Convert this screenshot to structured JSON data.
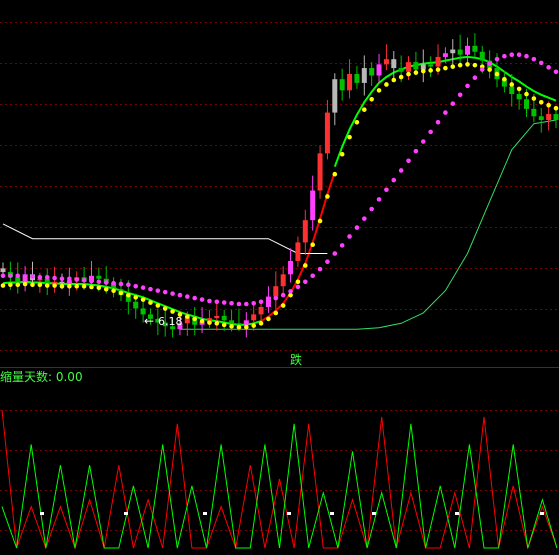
{
  "colors": {
    "background": "#000000",
    "grid": "#7a0000",
    "up": "#ff3030",
    "up_magenta": "#ff40ff",
    "down": "#00c000",
    "gray": "#b8b8b8",
    "yellow": "#ffff00",
    "magenta": "#ff40ff",
    "green_line": "#00ff00",
    "red_line": "#ff0000",
    "white": "#ffffff",
    "label_green": "#40ff40"
  },
  "main_panel": {
    "low_label": "6.18",
    "low_arrow": "←"
  },
  "divider_label": "跌",
  "indicator_panel": {
    "label": "缩量天数: 0.00"
  },
  "chart_data": [
    {
      "type": "candlestick",
      "panel": "price",
      "low_marker": 6.18,
      "close": [
        6.95,
        6.88,
        6.8,
        6.92,
        6.84,
        6.86,
        6.78,
        6.82,
        6.8,
        6.84,
        6.88,
        6.82,
        6.9,
        6.86,
        6.8,
        6.72,
        6.64,
        6.55,
        6.46,
        6.38,
        6.32,
        6.27,
        6.22,
        6.18,
        6.26,
        6.34,
        6.24,
        6.28,
        6.33,
        6.36,
        6.3,
        6.26,
        6.24,
        6.3,
        6.38,
        6.48,
        6.62,
        6.76,
        6.92,
        7.1,
        7.35,
        7.65,
        8.05,
        8.55,
        9.1,
        9.55,
        9.4,
        9.62,
        9.5,
        9.7,
        9.6,
        9.75,
        9.82,
        9.7,
        9.65,
        9.78,
        9.68,
        9.75,
        9.72,
        9.85,
        9.9,
        9.95,
        9.88,
        10.0,
        9.92,
        9.8,
        9.7,
        9.55,
        9.45,
        9.35,
        9.28,
        9.15,
        9.05,
        9.0,
        9.08,
        9.0
      ],
      "ma_yellow_dotted": [
        6.85,
        6.86,
        6.86,
        6.87,
        6.86,
        6.86,
        6.85,
        6.85,
        6.84,
        6.84,
        6.84,
        6.84,
        6.83,
        6.82,
        6.8,
        6.78,
        6.75,
        6.72,
        6.69,
        6.66,
        6.62,
        6.58,
        6.54,
        6.5,
        6.46,
        6.43,
        6.4,
        6.37,
        6.35,
        6.34,
        6.32,
        6.3,
        6.29,
        6.29,
        6.31,
        6.34,
        6.4,
        6.48,
        6.58,
        6.72,
        6.9,
        7.12,
        7.4,
        7.72,
        8.05,
        8.35,
        8.62,
        8.85,
        9.05,
        9.22,
        9.36,
        9.48,
        9.56,
        9.62,
        9.66,
        9.7,
        9.72,
        9.74,
        9.75,
        9.76,
        9.78,
        9.8,
        9.82,
        9.83,
        9.82,
        9.8,
        9.76,
        9.7,
        9.63,
        9.56,
        9.5,
        9.43,
        9.37,
        9.32,
        9.28,
        9.24
      ],
      "ma_magenta_dotted": [
        6.9,
        6.9,
        6.9,
        6.89,
        6.89,
        6.88,
        6.88,
        6.87,
        6.86,
        6.86,
        6.85,
        6.84,
        6.83,
        6.82,
        6.81,
        6.8,
        6.79,
        6.78,
        6.76,
        6.74,
        6.72,
        6.7,
        6.68,
        6.66,
        6.64,
        6.62,
        6.6,
        6.58,
        6.56,
        6.55,
        6.54,
        6.53,
        6.52,
        6.52,
        6.53,
        6.55,
        6.57,
        6.6,
        6.64,
        6.69,
        6.75,
        6.82,
        6.9,
        6.99,
        7.09,
        7.2,
        7.31,
        7.43,
        7.55,
        7.67,
        7.8,
        7.93,
        8.06,
        8.19,
        8.32,
        8.45,
        8.58,
        8.71,
        8.84,
        8.97,
        9.1,
        9.22,
        9.34,
        9.46,
        9.57,
        9.68,
        9.76,
        9.82,
        9.86,
        9.88,
        9.88,
        9.86,
        9.82,
        9.77,
        9.71,
        9.65
      ],
      "support_line": [
        6.18,
        6.18,
        6.18,
        6.18,
        6.18,
        6.18,
        6.18,
        6.18,
        6.18,
        6.2,
        6.26,
        6.4,
        6.7,
        7.2,
        7.9,
        8.6,
        8.95,
        9.0
      ],
      "upper_white_line": [
        7.6,
        7.4,
        7.4,
        7.4,
        7.4,
        7.4,
        7.4,
        7.4,
        7.4,
        7.4,
        7.2,
        7.2
      ]
    },
    {
      "type": "line",
      "panel": "indicator",
      "series": [
        {
          "color": "red",
          "values": [
            1.0,
            0.0,
            0.3,
            0.0,
            0.3,
            0.0,
            0.35,
            0.0,
            0.6,
            0.0,
            0.35,
            0.0,
            0.9,
            0.0,
            0.0,
            0.3,
            0.0,
            0.6,
            0.0,
            0.5,
            0.0,
            0.9,
            0.0,
            0.0,
            0.35,
            0.0,
            0.95,
            0.0,
            0.4,
            0.0,
            0.0,
            0.4,
            0.0,
            0.95,
            0.0,
            0.45,
            0.0,
            0.3,
            0.0
          ]
        },
        {
          "color": "green",
          "values": [
            0.3,
            0.0,
            0.75,
            0.0,
            0.6,
            0.0,
            0.6,
            0.0,
            0.0,
            0.45,
            0.0,
            0.75,
            0.0,
            0.45,
            0.0,
            0.75,
            0.0,
            0.0,
            0.75,
            0.0,
            0.9,
            0.0,
            0.4,
            0.0,
            0.7,
            0.0,
            0.4,
            0.0,
            0.9,
            0.0,
            0.45,
            0.0,
            0.75,
            0.0,
            0.0,
            0.75,
            0.0,
            0.35,
            0.0
          ]
        }
      ]
    }
  ]
}
